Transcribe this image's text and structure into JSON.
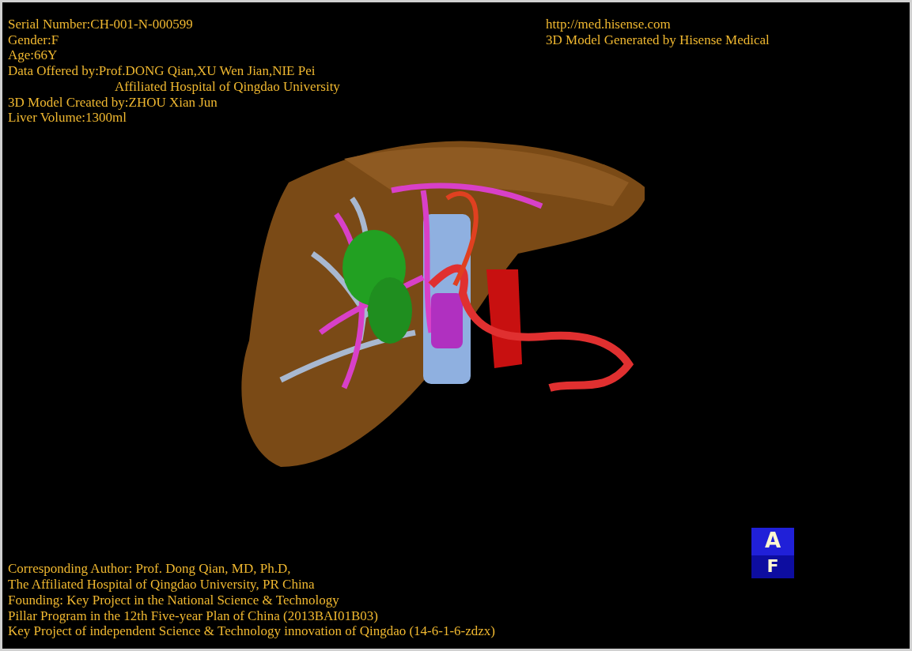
{
  "patient_info": [
    {
      "kind": "line",
      "text": "Serial Number:CH-001-N-000599"
    },
    {
      "kind": "line",
      "text": "Gender:F"
    },
    {
      "kind": "line",
      "text": "Age:66Y"
    },
    {
      "kind": "line",
      "text": "Data Offered by:Prof.DONG Qian,XU Wen Jian,NIE Pei"
    },
    {
      "kind": "continuation",
      "text": "Affiliated Hospital of Qingdao University"
    },
    {
      "kind": "line",
      "text": "3D Model Created by:ZHOU Xian Jun"
    },
    {
      "kind": "line",
      "text": "Liver Volume:1300ml"
    }
  ],
  "website": "http://med.hisense.com",
  "generator": "3D Model Generated by Hisense Medical",
  "orientation_cube": {
    "top_face": "A",
    "front_face": "F"
  },
  "credits": [
    "Corresponding Author: Prof. Dong Qian, MD, Ph.D,",
    "The Affiliated Hospital of Qingdao University, PR China",
    "Founding: Key Project in the National Science & Technology",
    "Pillar Program in the 12th Five-year Plan of China (2013BAI01B03)",
    "Key Project of independent Science & Technology innovation of Qingdao (14-6-1-6-zdzx)"
  ]
}
